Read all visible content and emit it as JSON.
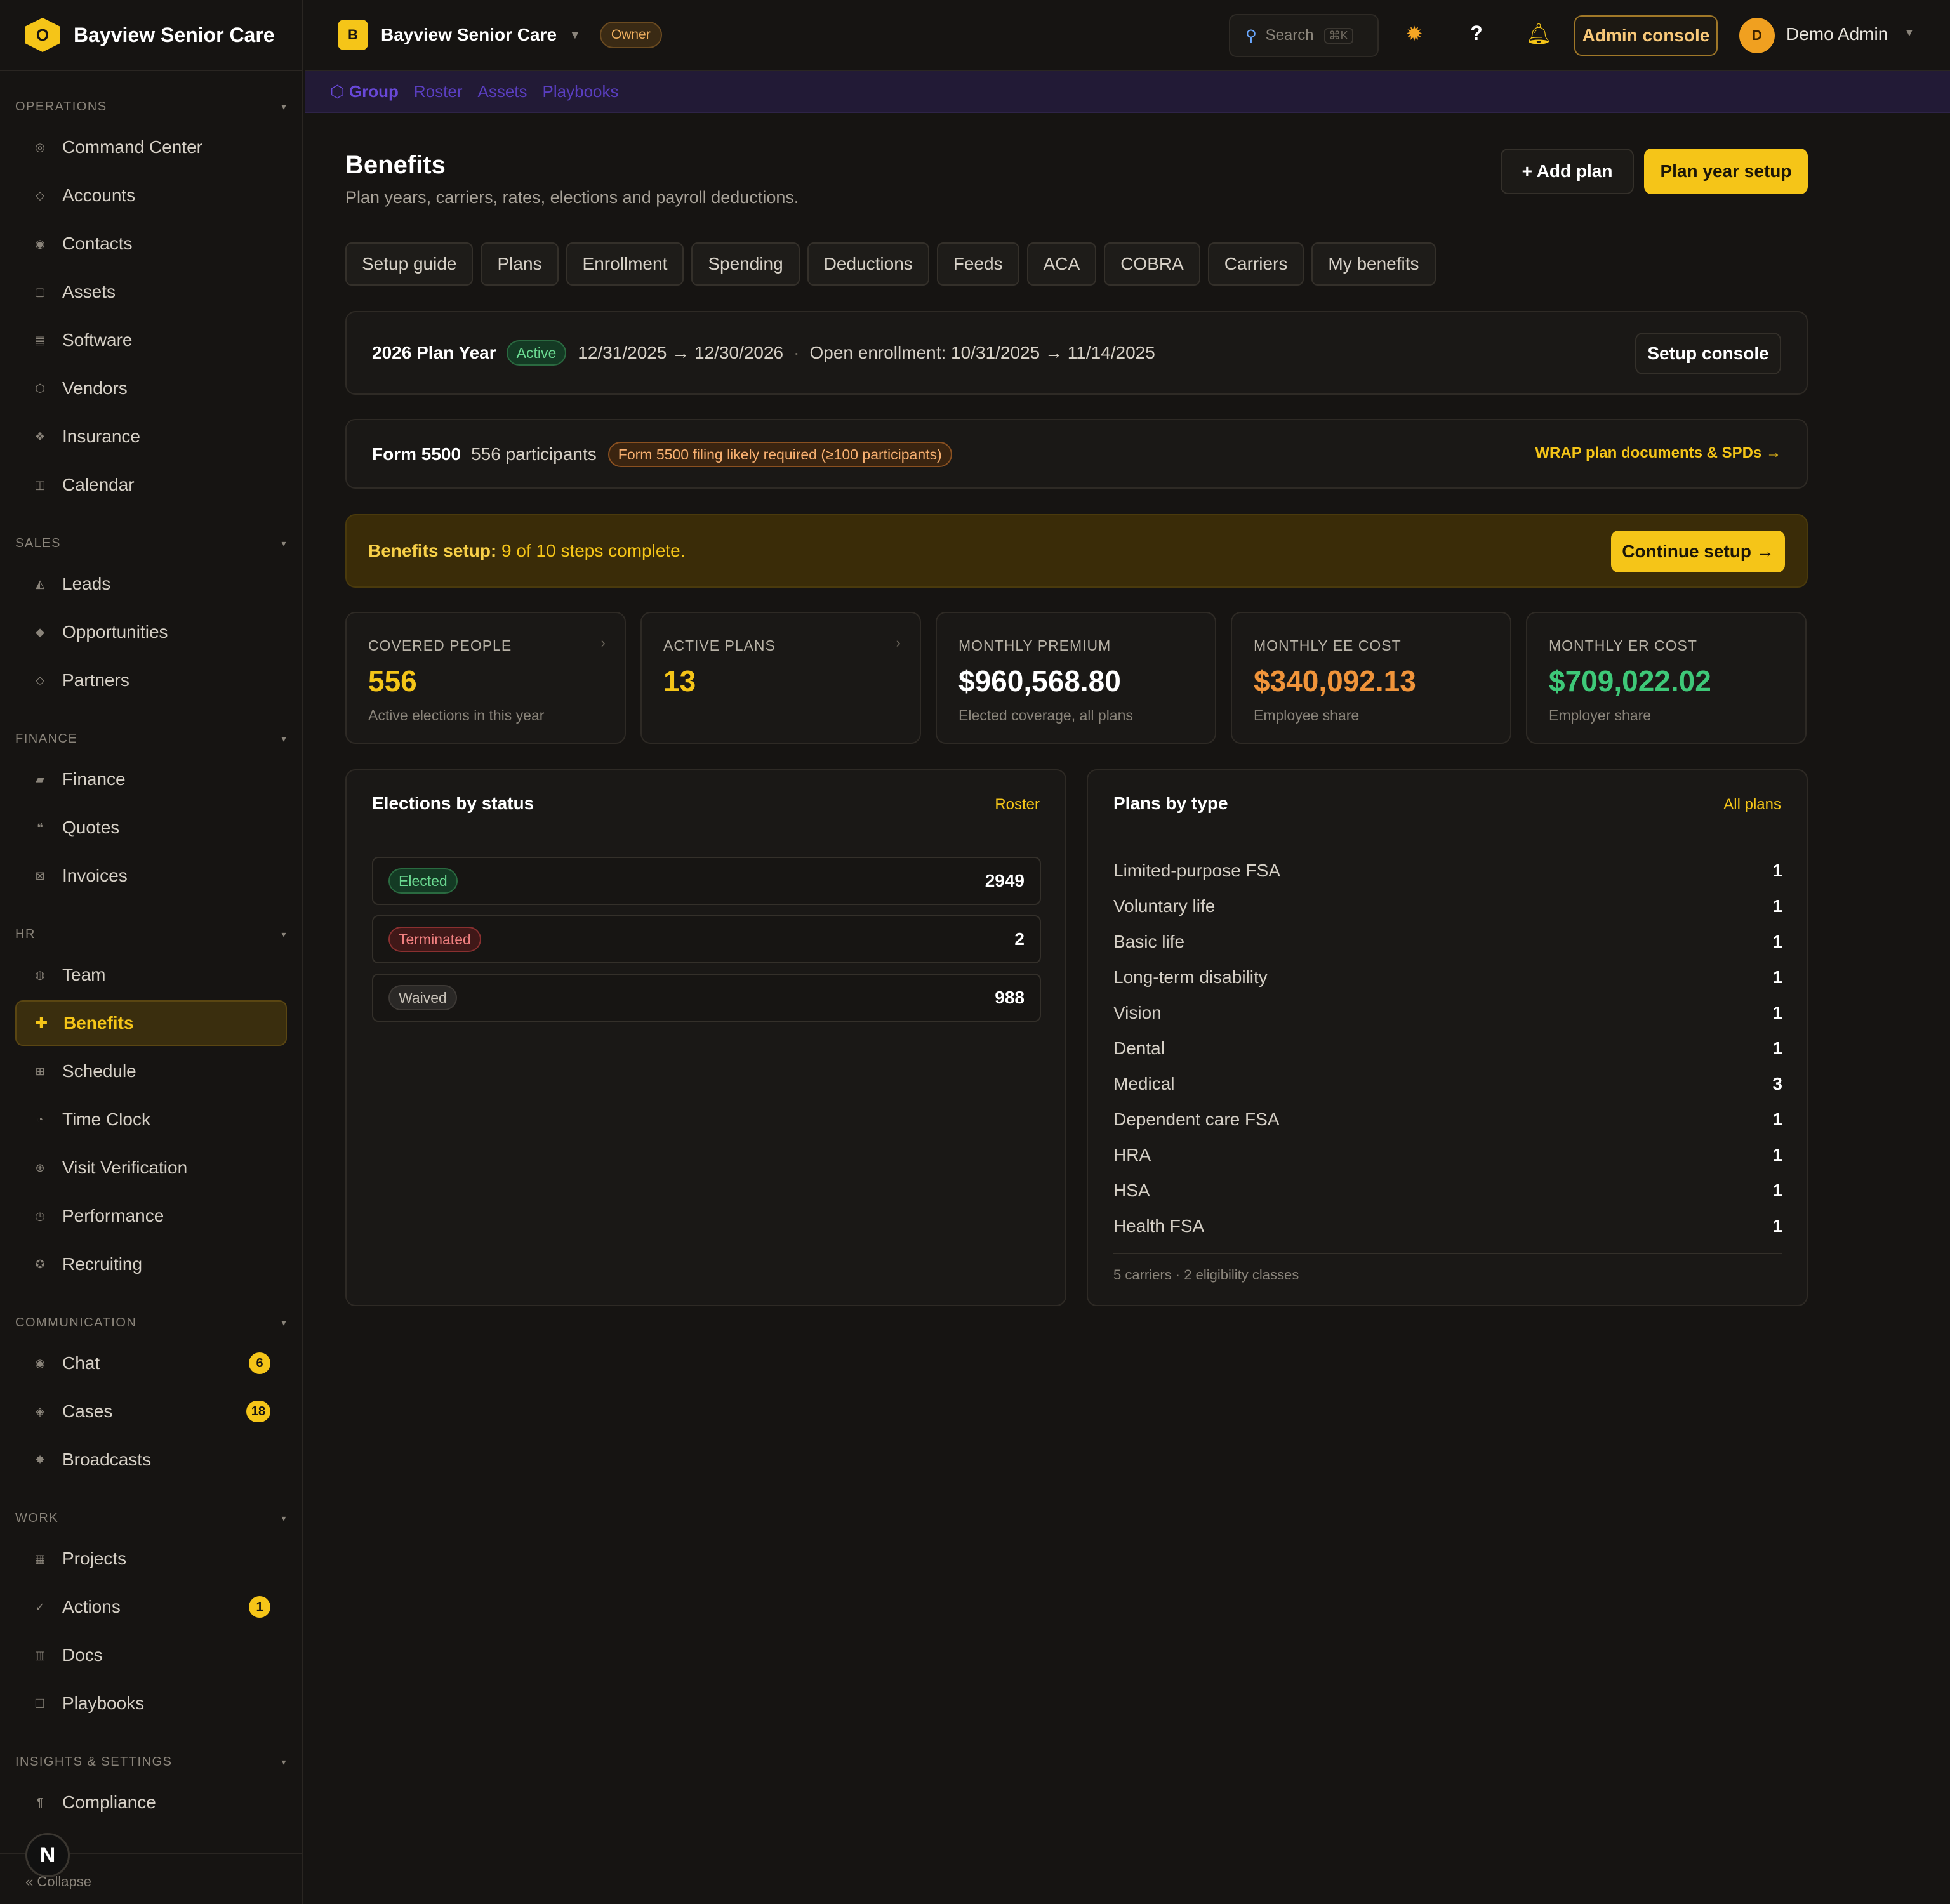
{
  "brand": {
    "logo_letter": "O",
    "name": "Bayview Senior Care"
  },
  "sidebar": {
    "sections": [
      {
        "title": "OPERATIONS",
        "items": [
          {
            "label": "Command Center",
            "icon": "◎"
          },
          {
            "label": "Accounts",
            "icon": "◇"
          },
          {
            "label": "Contacts",
            "icon": "◉"
          },
          {
            "label": "Assets",
            "icon": "▢"
          },
          {
            "label": "Software",
            "icon": "▤"
          },
          {
            "label": "Vendors",
            "icon": "⬡"
          },
          {
            "label": "Insurance",
            "icon": "❖"
          },
          {
            "label": "Calendar",
            "icon": "◫"
          }
        ]
      },
      {
        "title": "SALES",
        "items": [
          {
            "label": "Leads",
            "icon": "◭"
          },
          {
            "label": "Opportunities",
            "icon": "◆"
          },
          {
            "label": "Partners",
            "icon": "◇"
          }
        ]
      },
      {
        "title": "FINANCE",
        "items": [
          {
            "label": "Finance",
            "icon": "▰"
          },
          {
            "label": "Quotes",
            "icon": "❝"
          },
          {
            "label": "Invoices",
            "icon": "⊠"
          }
        ]
      },
      {
        "title": "HR",
        "items": [
          {
            "label": "Team",
            "icon": "◍"
          },
          {
            "label": "Benefits",
            "icon": "✚",
            "active": true
          },
          {
            "label": "Schedule",
            "icon": "⊞"
          },
          {
            "label": "Time Clock",
            "icon": "◔"
          },
          {
            "label": "Visit Verification",
            "icon": "⊕"
          },
          {
            "label": "Performance",
            "icon": "◷"
          },
          {
            "label": "Recruiting",
            "icon": "✪"
          }
        ]
      },
      {
        "title": "COMMUNICATION",
        "items": [
          {
            "label": "Chat",
            "icon": "◉",
            "badge": "6"
          },
          {
            "label": "Cases",
            "icon": "◈",
            "badge": "18"
          },
          {
            "label": "Broadcasts",
            "icon": "✸"
          }
        ]
      },
      {
        "title": "WORK",
        "items": [
          {
            "label": "Projects",
            "icon": "▦"
          },
          {
            "label": "Actions",
            "icon": "✓",
            "badge": "1"
          },
          {
            "label": "Docs",
            "icon": "▥"
          },
          {
            "label": "Playbooks",
            "icon": "❏"
          }
        ]
      },
      {
        "title": "INSIGHTS & SETTINGS",
        "items": [
          {
            "label": "Compliance",
            "icon": "¶"
          }
        ]
      }
    ],
    "collapse_label": "« Collapse",
    "avatar_letter": "N"
  },
  "topbar": {
    "org_letter": "B",
    "org_name": "Bayview Senior Care",
    "role": "Owner",
    "search_placeholder": "Search",
    "search_kbd": "⌘K",
    "admin_console": "Admin console",
    "user_letter": "D",
    "user_name": "Demo Admin"
  },
  "subnav": {
    "items": [
      "⬡ Group",
      "Roster",
      "Assets",
      "Playbooks"
    ]
  },
  "page": {
    "title": "Benefits",
    "subtitle": "Plan years, carriers, rates, elections and payroll deductions.",
    "add_plan": "+ Add plan",
    "plan_year_setup": "Plan year setup",
    "tabs": [
      "Setup guide",
      "Plans",
      "Enrollment",
      "Spending",
      "Deductions",
      "Feeds",
      "ACA",
      "COBRA",
      "Carriers",
      "My benefits"
    ]
  },
  "plan_year": {
    "title": "2026 Plan Year",
    "status": "Active",
    "range": "12/31/2025 → 12/30/2026",
    "sep": "·",
    "open_enrollment": "Open enrollment: 10/31/2025 → 11/14/2025",
    "setup_console": "Setup console"
  },
  "form5500": {
    "title": "Form 5500",
    "participants": "556 participants",
    "warning": "Form 5500 filing likely required (≥100 participants)",
    "link": "WRAP plan documents & SPDs →"
  },
  "setup": {
    "label": "Benefits setup:",
    "progress": "9 of 10 steps complete.",
    "cta": "Continue setup →"
  },
  "kpis": [
    {
      "label": "COVERED PEOPLE",
      "value": "556",
      "sub": "Active elections in this year",
      "color": "#f5c518",
      "chevron": true
    },
    {
      "label": "ACTIVE PLANS",
      "value": "13",
      "sub": "",
      "color": "#f5c518",
      "chevron": true
    },
    {
      "label": "MONTHLY PREMIUM",
      "value": "$960,568.80",
      "sub": "Elected coverage, all plans",
      "color": "#ffffff",
      "chevron": false
    },
    {
      "label": "MONTHLY EE COST",
      "value": "$340,092.13",
      "sub": "Employee share",
      "color": "#f0943a",
      "chevron": false
    },
    {
      "label": "MONTHLY ER COST",
      "value": "$709,022.02",
      "sub": "Employer share",
      "color": "#3ec878",
      "chevron": false
    }
  ],
  "elections": {
    "title": "Elections by status",
    "link": "Roster",
    "rows": [
      {
        "status": "Elected",
        "count": "2949",
        "tone": "green"
      },
      {
        "status": "Terminated",
        "count": "2",
        "tone": "red"
      },
      {
        "status": "Waived",
        "count": "988",
        "tone": "gray"
      }
    ]
  },
  "plans_by_type": {
    "title": "Plans by type",
    "link": "All plans",
    "rows": [
      {
        "type": "Limited-purpose FSA",
        "count": "1"
      },
      {
        "type": "Voluntary life",
        "count": "1"
      },
      {
        "type": "Basic life",
        "count": "1"
      },
      {
        "type": "Long-term disability",
        "count": "1"
      },
      {
        "type": "Vision",
        "count": "1"
      },
      {
        "type": "Dental",
        "count": "1"
      },
      {
        "type": "Medical",
        "count": "3"
      },
      {
        "type": "Dependent care FSA",
        "count": "1"
      },
      {
        "type": "HRA",
        "count": "1"
      },
      {
        "type": "HSA",
        "count": "1"
      },
      {
        "type": "Health FSA",
        "count": "1"
      }
    ],
    "footer": "5 carriers · 2 eligibility classes"
  }
}
